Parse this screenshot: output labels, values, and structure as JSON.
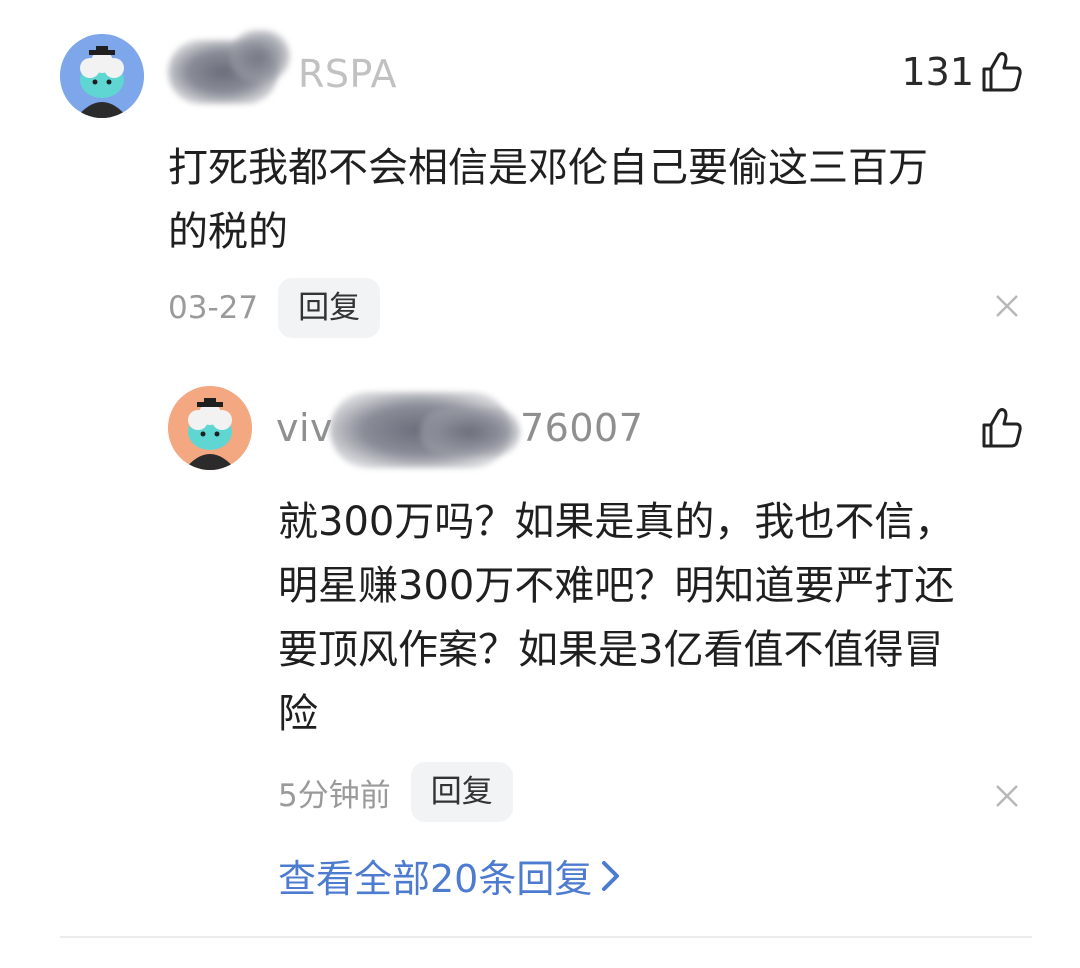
{
  "comment": {
    "username": "RSPA",
    "likes": "131",
    "text_lines": [
      "打死我都不会相信是邓伦自己要偷这三百万",
      "的税的"
    ],
    "date": "03-27",
    "reply_label": "回复"
  },
  "reply": {
    "username_prefix": "viv",
    "username_suffix": "76007",
    "likes": "",
    "text_lines": [
      "就300万吗？如果是真的，我也不信，",
      "明星赚300万不难吧？明知道要严打还",
      "要顶风作案？如果是3亿看值不值得冒",
      "险"
    ],
    "time": "5分钟前",
    "reply_label": "回复"
  },
  "view_all_label": "查看全部20条回复",
  "colors": {
    "avatar1_bg": "#7ea6ea",
    "avatar2_bg": "#f4a882",
    "link": "#4d7bd0"
  },
  "icons": [
    "thumbs-up-icon",
    "close-icon",
    "chevron-right-icon",
    "avatar-icon"
  ]
}
